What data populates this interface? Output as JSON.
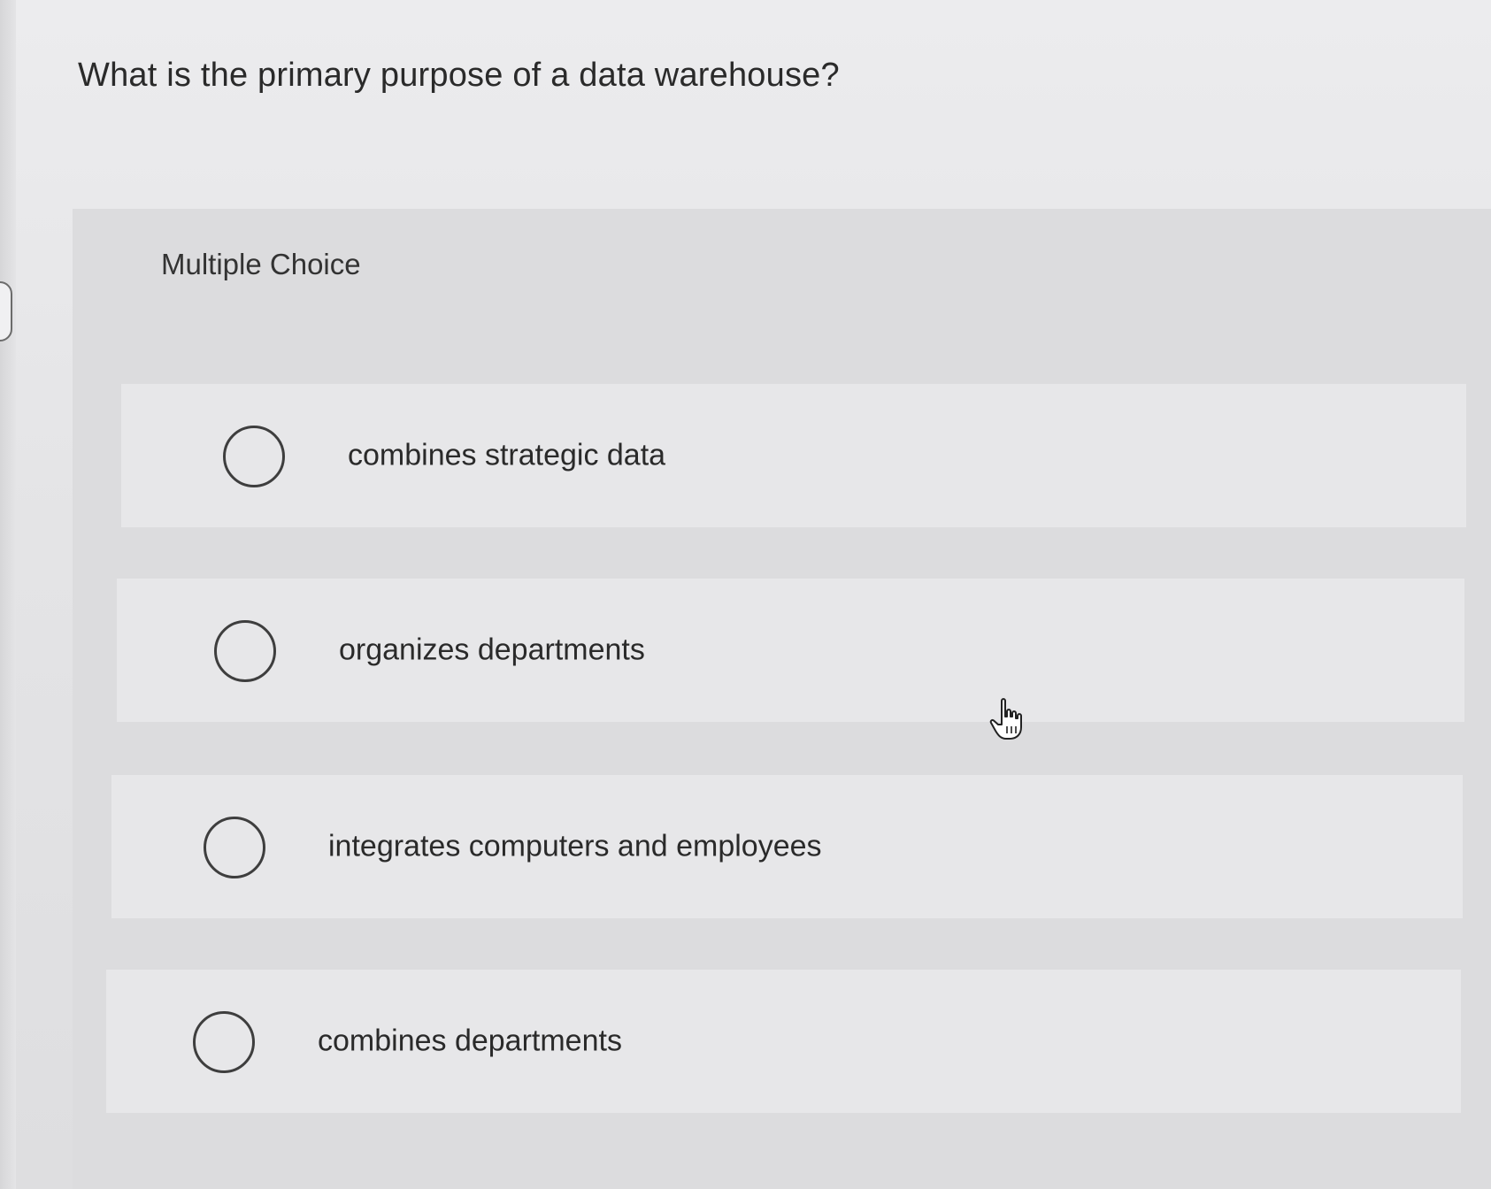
{
  "question": {
    "text": "What is the primary purpose of a data warehouse?"
  },
  "question_type": "Multiple Choice",
  "choices": [
    {
      "label": "combines strategic data",
      "selected": false
    },
    {
      "label": "organizes departments",
      "selected": false
    },
    {
      "label": "integrates computers and employees",
      "selected": false
    },
    {
      "label": "combines departments",
      "selected": false
    }
  ],
  "cursor": {
    "icon": "hand-pointer-icon"
  }
}
